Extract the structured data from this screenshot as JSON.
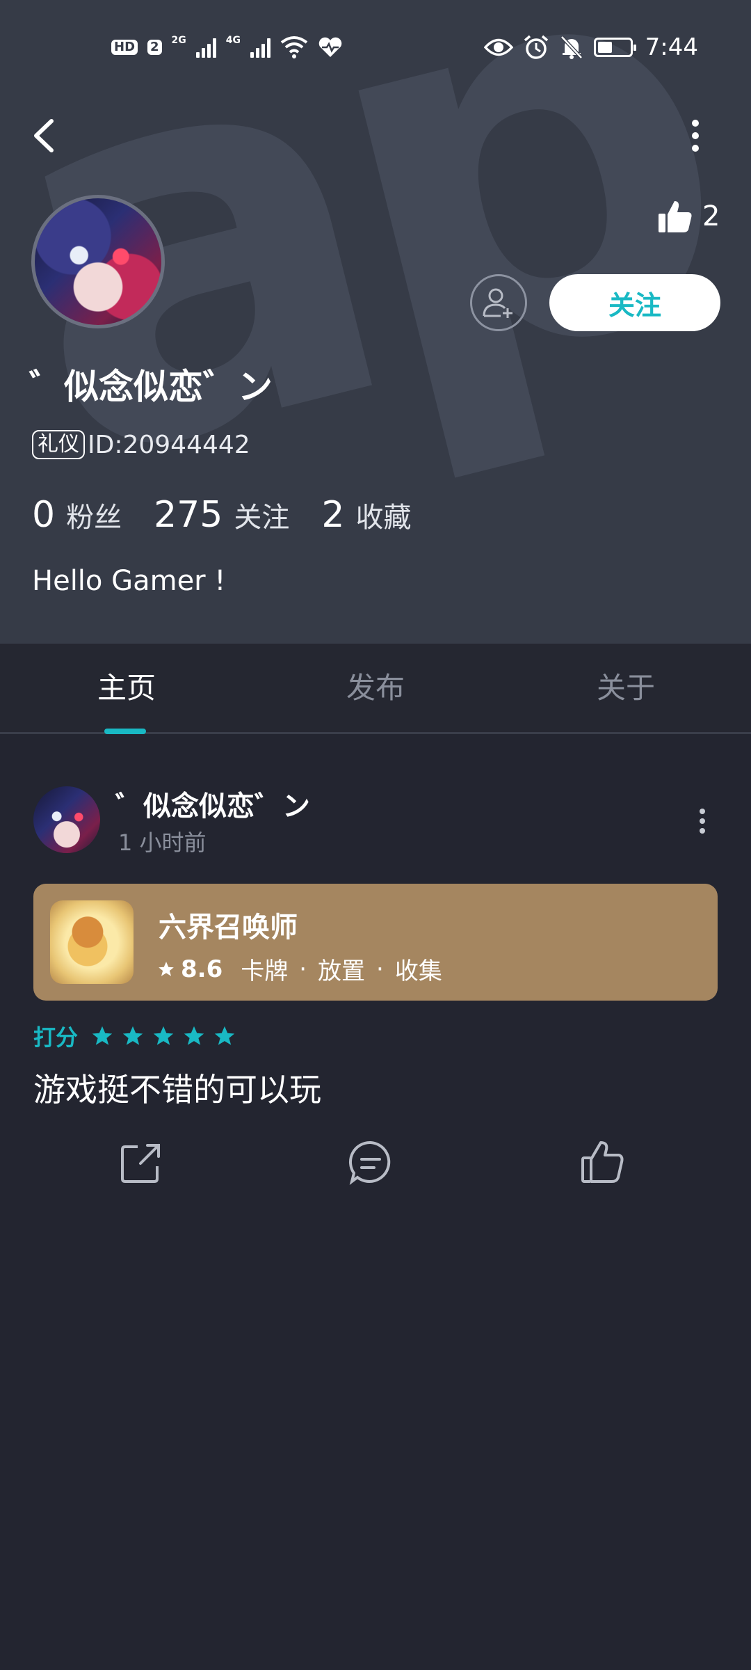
{
  "status_bar": {
    "hd_badge": "HD",
    "sim_badge": "2",
    "net1": "2G",
    "net2": "4G",
    "time": "7:44"
  },
  "profile": {
    "like_count": "2",
    "follow_label": "关注",
    "username": "゛似念似恋゛ン",
    "id_badge": "礼仪",
    "id_text": "ID:20944442",
    "stats": [
      {
        "value": "0",
        "label": "粉丝"
      },
      {
        "value": "275",
        "label": "关注"
      },
      {
        "value": "2",
        "label": "收藏"
      }
    ],
    "bio": "Hello Gamer !"
  },
  "tabs": [
    {
      "label": "主页",
      "active": true
    },
    {
      "label": "发布",
      "active": false
    },
    {
      "label": "关于",
      "active": false
    }
  ],
  "post": {
    "author": "゛似念似恋゛ン",
    "time": "1 小时前",
    "game": {
      "name": "六界召唤师",
      "score": "8.6",
      "tags": [
        "卡牌",
        "放置",
        "收集"
      ]
    },
    "rating_label": "打分",
    "rating_stars": 5,
    "body": "游戏挺不错的可以玩"
  },
  "colors": {
    "accent": "#19b9c4",
    "header_bg": "#363b47",
    "page_bg": "#232530",
    "card_bg": "#a58660"
  }
}
